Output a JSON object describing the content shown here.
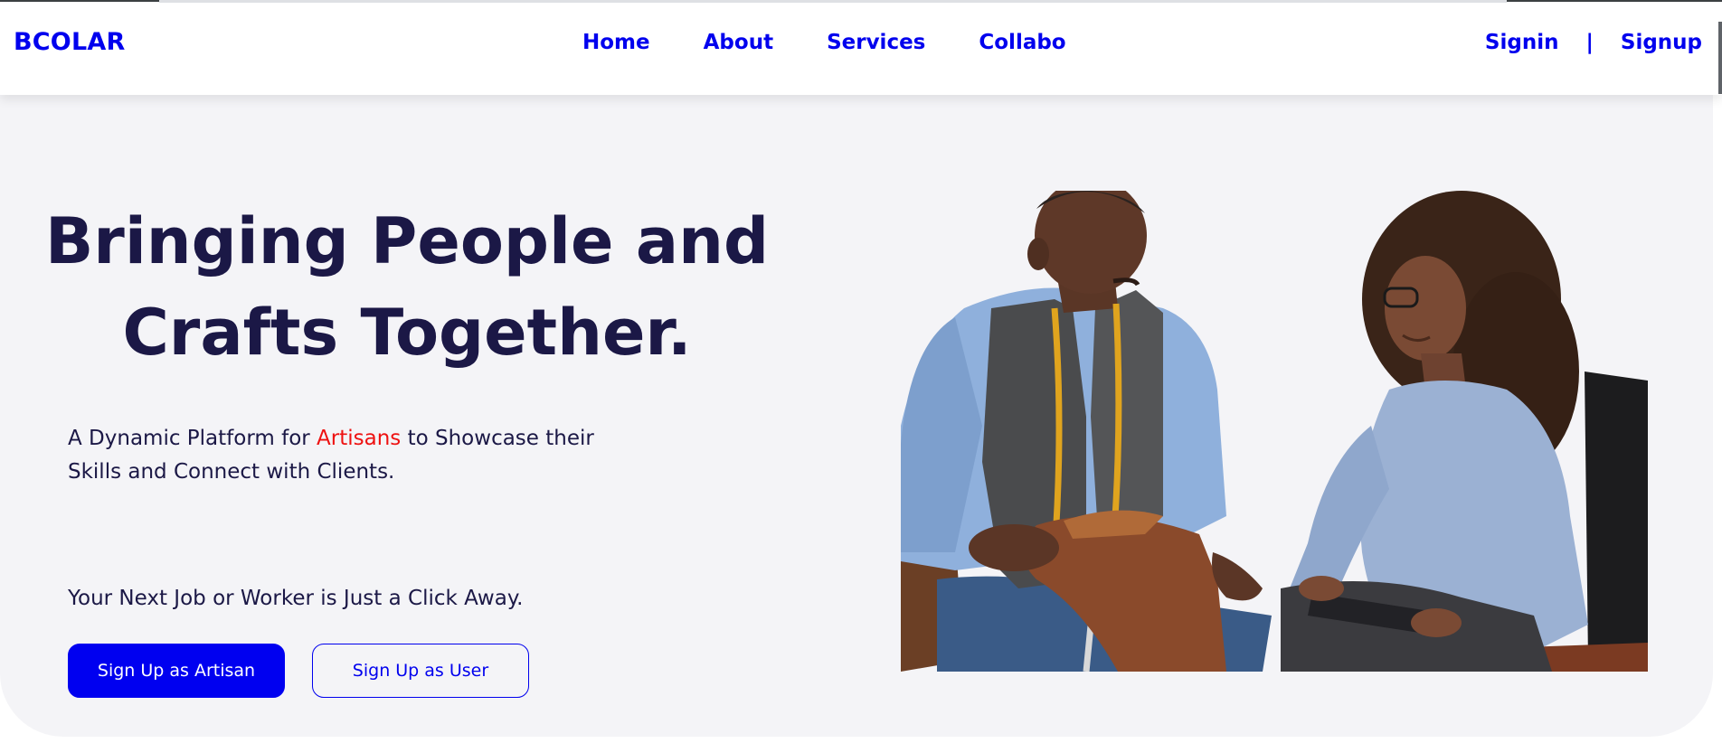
{
  "navbar": {
    "brand": "BCOLAR",
    "links": [
      "Home",
      "About",
      "Services",
      "Collabo"
    ],
    "signin_label": "Signin",
    "separator": "|",
    "signup_label": "Signup"
  },
  "hero": {
    "title_line1": "Bringing People and",
    "title_line2": "Crafts Together.",
    "subtitle_before": "A Dynamic Platform for ",
    "subtitle_accent": "Artisans",
    "subtitle_after": " to Showcase their Skills and Connect with Clients.",
    "tagline": "Your Next Job or Worker is Just a Click Away.",
    "primary_button": "Sign Up as Artisan",
    "secondary_button": "Sign Up as User"
  },
  "colors": {
    "brand_blue": "#0000ee",
    "heading": "#1b1846",
    "accent_red": "#ee1111",
    "hero_background": "#f4f4f7"
  }
}
